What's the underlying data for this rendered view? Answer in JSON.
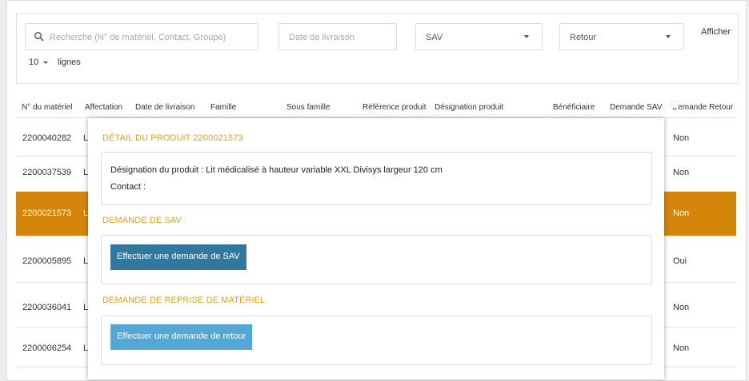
{
  "filters": {
    "search_placeholder": "Recherche (N° de matériel, Contact, Groupe)",
    "date_placeholder": "Date de livraison",
    "sav_value": "SAV",
    "retour_value": "Retour",
    "afficher_label": "Afficher",
    "lines_value": "10",
    "lines_label": "lignes"
  },
  "table": {
    "headers": [
      "N° du matériel",
      "Affectation",
      "Date de livraison",
      "Famille",
      "Sous famille",
      "Référence produit",
      "Désignation produit",
      "Bénéficiaire",
      "Demande SAV",
      "Demande Retour"
    ],
    "rows": [
      {
        "id": "2200040282",
        "aff": "L",
        "retour": "Non"
      },
      {
        "id": "2200037539",
        "aff": "L",
        "retour": "Non"
      },
      {
        "id": "2200021573",
        "aff": "L",
        "retour": "Non"
      },
      {
        "id": "2200005895",
        "aff": "L",
        "retour": "Oui"
      },
      {
        "id": "2200036041",
        "aff": "L",
        "retour": "Non"
      },
      {
        "id": "2200006254",
        "aff": "L",
        "retour": "Non"
      }
    ]
  },
  "modal": {
    "close_glyph": "✖",
    "detail_title": "DÉTAIL DU PRODUIT 2200021573",
    "designation": "Désignation du produit : Lit médicalisé à hauteur variable XXL Divisys largeur 120 cm",
    "contact": "Contact :",
    "sav_title": "DEMANDE DE SAV",
    "sav_button": "Effectuer une demande de SAV",
    "reprise_title": "DEMANDE DE REPRISE DE MATÉRIEL",
    "retour_button": "Effectuer une demande de retour"
  },
  "colors": {
    "accent": "#e8a21a",
    "selected_row": "#d4860b",
    "btn_sav": "#32789e",
    "btn_retour": "#55a8d6"
  }
}
